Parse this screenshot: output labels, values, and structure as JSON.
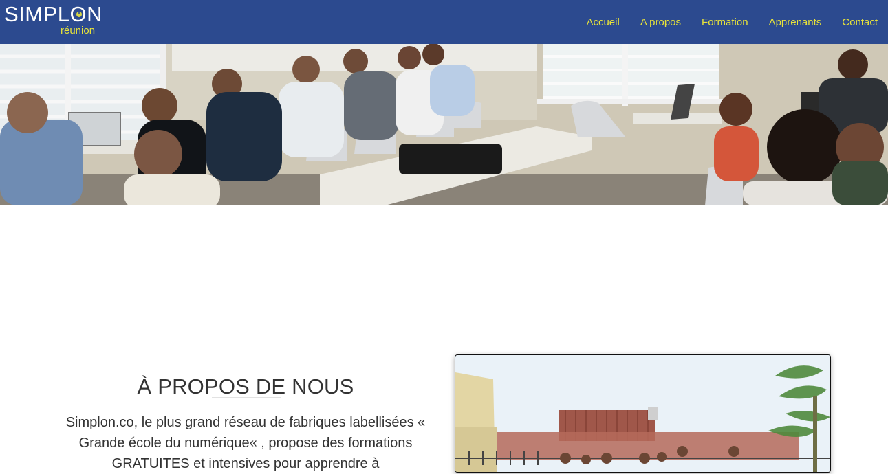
{
  "brand": {
    "name": "SIMPLON",
    "sub": "réunion",
    "color_primary": "#2c4a8f",
    "color_accent": "#e8e33a"
  },
  "nav": {
    "items": [
      {
        "label": "Accueil"
      },
      {
        "label": "A propos"
      },
      {
        "label": "Formation"
      },
      {
        "label": "Apprenants"
      },
      {
        "label": "Contact"
      }
    ]
  },
  "hero": {
    "image": "classroom-photo"
  },
  "about": {
    "title": "À PROPOS DE NOUS",
    "text": "Simplon.co, le plus grand réseau de fabriques labellisées « Grande école du numérique« , propose des formations GRATUITES et intensives pour apprendre à",
    "photo": "group-photo"
  }
}
